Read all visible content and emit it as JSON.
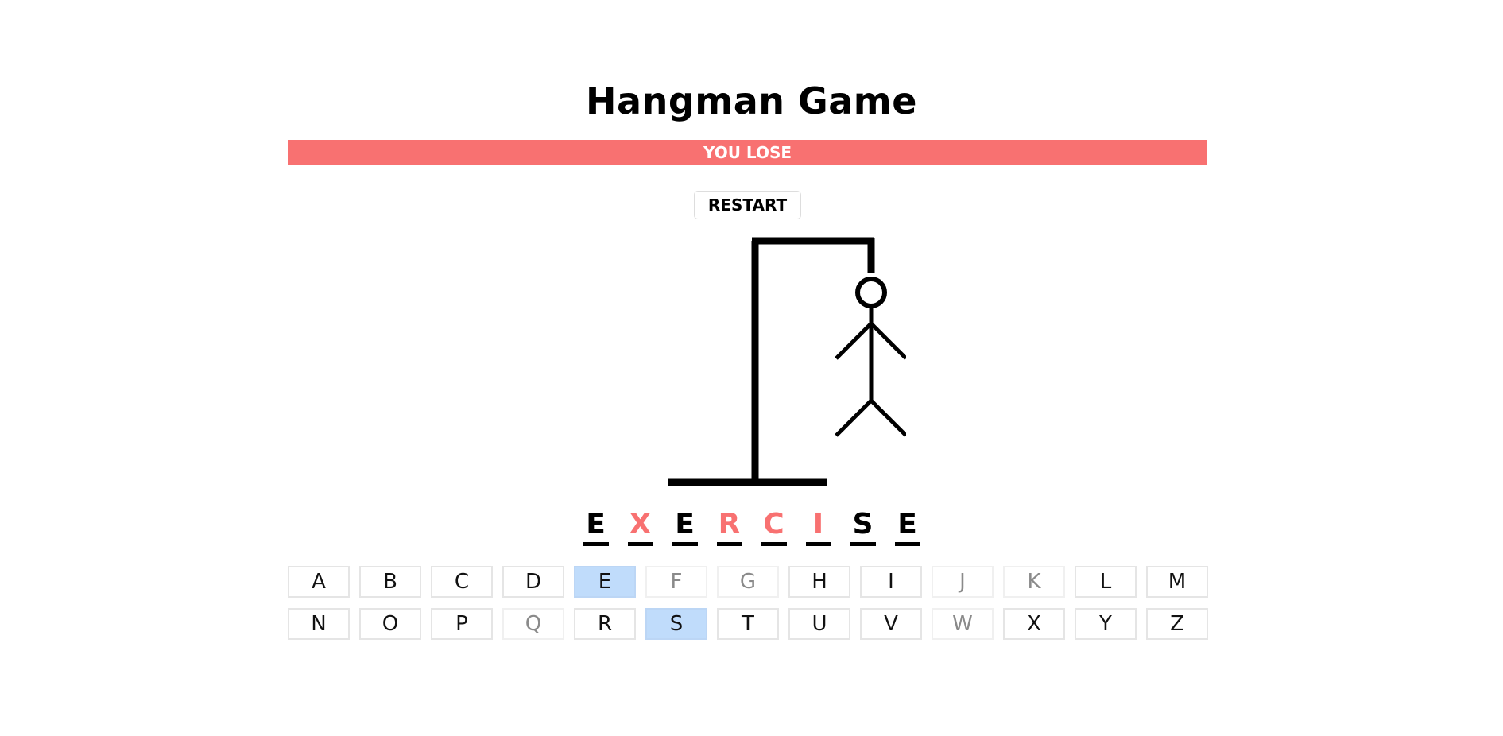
{
  "title": "Hangman Game",
  "status": "YOU LOSE",
  "restart_label": "RESTART",
  "colors": {
    "lose": "#f87171",
    "correct_key": "#c0dcfb",
    "wrong_key_text": "#8a8a8a"
  },
  "word": [
    {
      "letter": "E",
      "state": "guessed"
    },
    {
      "letter": "X",
      "state": "missed"
    },
    {
      "letter": "E",
      "state": "guessed"
    },
    {
      "letter": "R",
      "state": "missed"
    },
    {
      "letter": "C",
      "state": "missed"
    },
    {
      "letter": "I",
      "state": "missed"
    },
    {
      "letter": "S",
      "state": "guessed"
    },
    {
      "letter": "E",
      "state": "guessed"
    }
  ],
  "keys": [
    {
      "letter": "A",
      "state": "unused"
    },
    {
      "letter": "B",
      "state": "unused"
    },
    {
      "letter": "C",
      "state": "unused"
    },
    {
      "letter": "D",
      "state": "unused"
    },
    {
      "letter": "E",
      "state": "correct"
    },
    {
      "letter": "F",
      "state": "wrong"
    },
    {
      "letter": "G",
      "state": "wrong"
    },
    {
      "letter": "H",
      "state": "unused"
    },
    {
      "letter": "I",
      "state": "unused"
    },
    {
      "letter": "J",
      "state": "wrong"
    },
    {
      "letter": "K",
      "state": "wrong"
    },
    {
      "letter": "L",
      "state": "unused"
    },
    {
      "letter": "M",
      "state": "unused"
    },
    {
      "letter": "N",
      "state": "unused"
    },
    {
      "letter": "O",
      "state": "unused"
    },
    {
      "letter": "P",
      "state": "unused"
    },
    {
      "letter": "Q",
      "state": "wrong"
    },
    {
      "letter": "R",
      "state": "unused"
    },
    {
      "letter": "S",
      "state": "correct"
    },
    {
      "letter": "T",
      "state": "unused"
    },
    {
      "letter": "U",
      "state": "unused"
    },
    {
      "letter": "V",
      "state": "unused"
    },
    {
      "letter": "W",
      "state": "wrong"
    },
    {
      "letter": "X",
      "state": "unused"
    },
    {
      "letter": "Y",
      "state": "unused"
    },
    {
      "letter": "Z",
      "state": "unused"
    }
  ],
  "hangman": {
    "wrong_guesses": 6,
    "max_wrong": 6
  }
}
